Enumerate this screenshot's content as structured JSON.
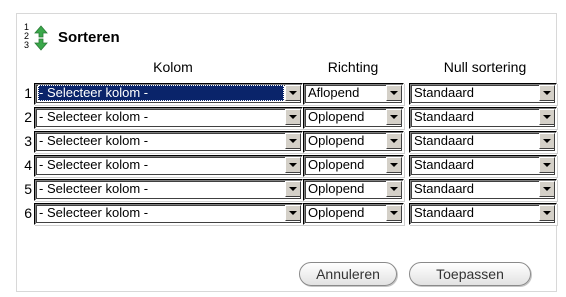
{
  "title": "Sorteren",
  "title_icon": "sort-arrows-icon",
  "title_icon_digits": [
    "1",
    "2",
    "3"
  ],
  "headers": {
    "kolom": "Kolom",
    "richting": "Richting",
    "null": "Null sortering"
  },
  "rows": [
    {
      "num": "1",
      "kolom": "- Selecteer kolom -",
      "richting": "Aflopend",
      "null": "Standaard"
    },
    {
      "num": "2",
      "kolom": "- Selecteer kolom -",
      "richting": "Oplopend",
      "null": "Standaard"
    },
    {
      "num": "3",
      "kolom": "- Selecteer kolom -",
      "richting": "Oplopend",
      "null": "Standaard"
    },
    {
      "num": "4",
      "kolom": "- Selecteer kolom -",
      "richting": "Oplopend",
      "null": "Standaard"
    },
    {
      "num": "5",
      "kolom": "- Selecteer kolom -",
      "richting": "Oplopend",
      "null": "Standaard"
    },
    {
      "num": "6",
      "kolom": "- Selecteer kolom -",
      "richting": "Oplopend",
      "null": "Standaard"
    }
  ],
  "buttons": {
    "cancel": "Annuleren",
    "apply": "Toepassen"
  },
  "colors": {
    "selection_highlight": "#0a246a",
    "icon_green": "#3aa84a"
  }
}
